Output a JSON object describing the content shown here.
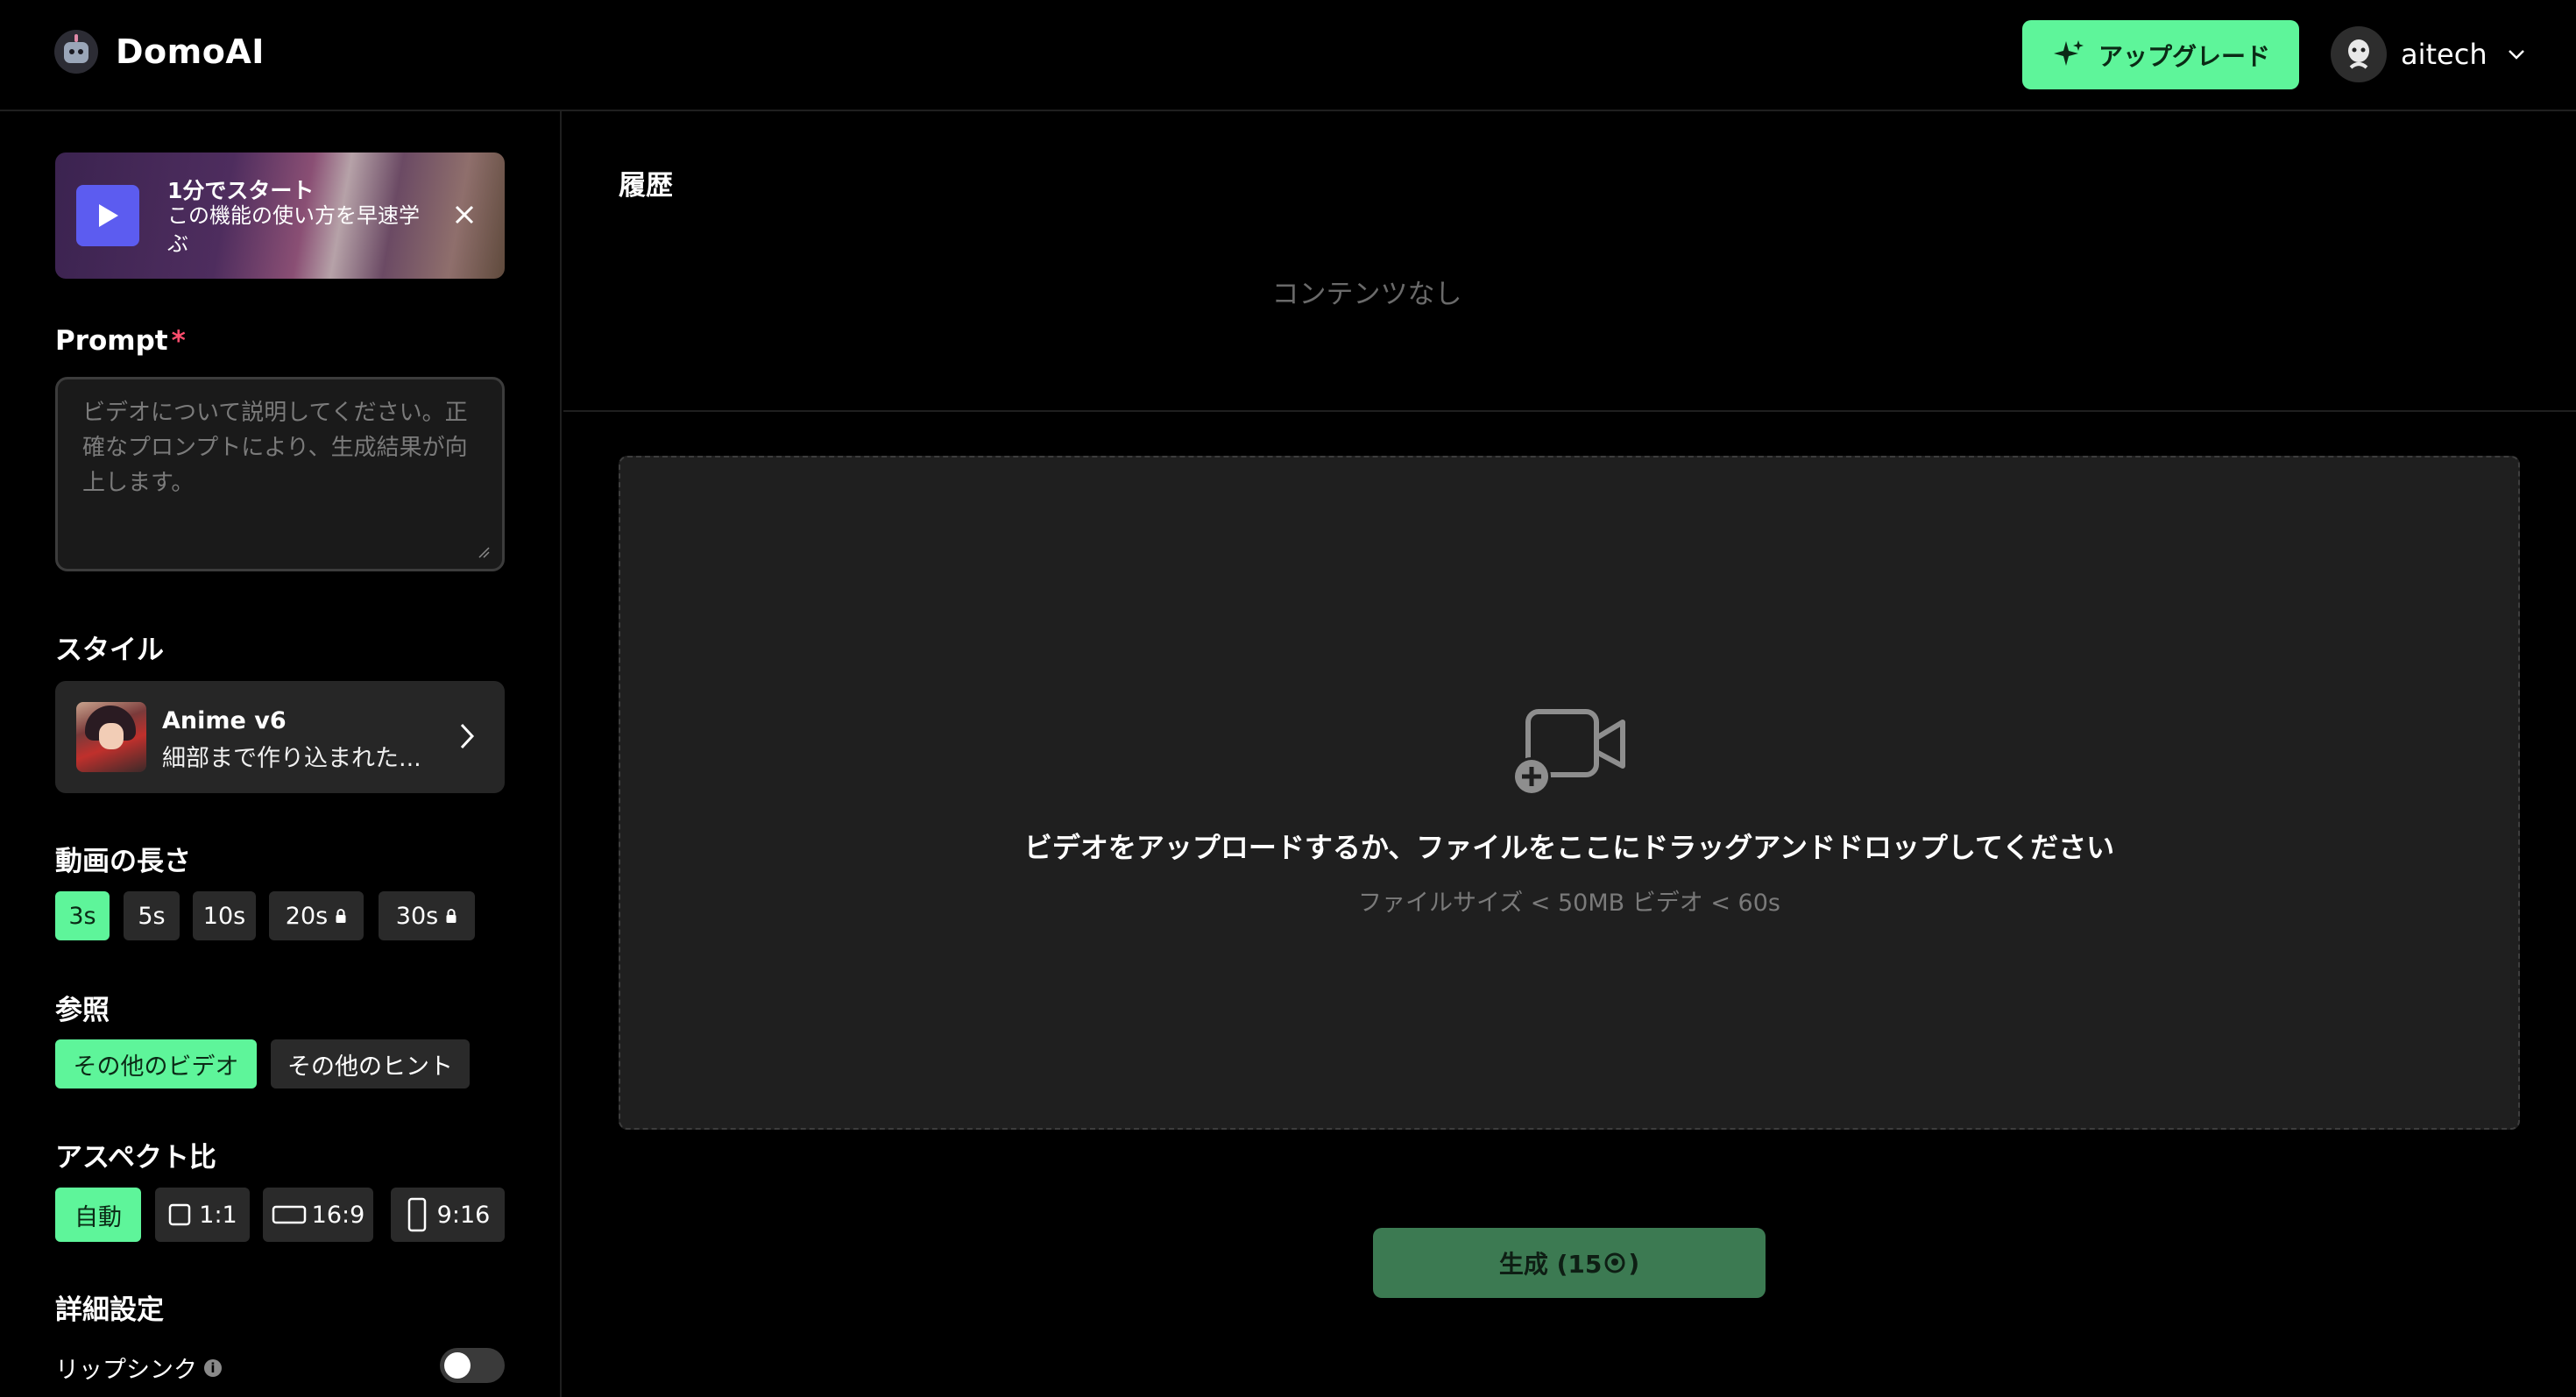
{
  "header": {
    "brand": "DomoAI",
    "upgrade_label": "アップグレード",
    "user_name": "aitech"
  },
  "sidebar": {
    "banner": {
      "title": "1分でスタート",
      "desc": "この機能の使い方を早速学ぶ"
    },
    "prompt": {
      "label": "Prompt",
      "required_mark": "*",
      "placeholder": "ビデオについて説明してください。正確なプロンプトにより、生成結果が向上します。"
    },
    "style": {
      "label": "スタイル",
      "name": "Anime v6",
      "desc": "細部まで作り込まれた..."
    },
    "duration": {
      "label": "動画の長さ",
      "options": [
        "3s",
        "5s",
        "10s",
        "20s",
        "30s"
      ],
      "selected": "3s",
      "locked": [
        "20s",
        "30s"
      ]
    },
    "reference": {
      "label": "参照",
      "options": [
        "その他のビデオ",
        "その他のヒント"
      ],
      "selected": "その他のビデオ"
    },
    "aspect": {
      "label": "アスペクト比",
      "options": [
        "自動",
        "1:1",
        "16:9",
        "9:16"
      ],
      "selected": "自動"
    },
    "advanced": {
      "label": "詳細設定",
      "lip_sync_label": "リップシンク",
      "lip_sync_on": false
    }
  },
  "main": {
    "history_title": "履歴",
    "empty_text": "コンテンツなし",
    "dropzone": {
      "main_text": "ビデオをアップロードするか、ファイルをここにドラッグアンドドロップしてください",
      "sub_text": "ファイルサイズ < 50MB    ビデオ < 60s"
    },
    "generate_label": "生成 (15",
    "generate_suffix": ")"
  },
  "colors": {
    "accent": "#5ef59a",
    "generate": "#3c7a52"
  }
}
